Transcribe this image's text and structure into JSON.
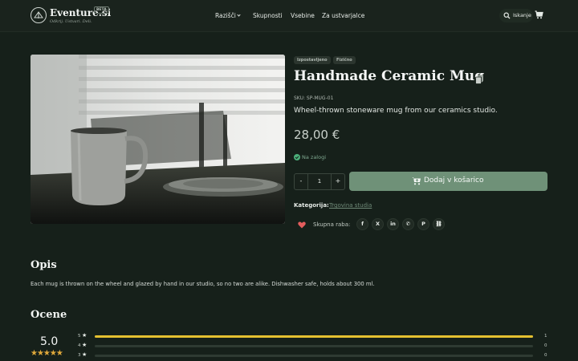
{
  "header": {
    "brand": "Eventure.si",
    "tagline": "Odkrij. Ustvari. Deli.",
    "beta": "BETA",
    "nav": [
      "Razišči",
      "Skupnosti",
      "Vsebine",
      "Za ustvarjalce"
    ],
    "search_label": "Iskanje"
  },
  "product": {
    "badges": [
      "Izpostavljeno",
      "Fizično"
    ],
    "title": "Handmade Ceramic Mug",
    "sku": "SKU: SP-MUG-01",
    "description": "Wheel-thrown stoneware mug from our ceramics studio.",
    "price": "28,00 €",
    "stock": "Na zalogi",
    "quantity": "1",
    "qty_minus": "-",
    "qty_plus": "+",
    "add_to_cart": "Dodaj v košarico",
    "category_label": "Kategorija:",
    "category_value": "Trgovina studia",
    "share_label": "Skupna raba:",
    "share_icons": [
      "f",
      "X",
      "in",
      "✆",
      "P",
      "⛓"
    ]
  },
  "description_section": {
    "heading": "Opis",
    "text": "Each mug is thrown on the wheel and glazed by hand in our studio, so no two are alike. Dishwasher safe, holds about 300 ml."
  },
  "ratings": {
    "heading": "Ocene",
    "average": "5.0",
    "stars": "★★★★★",
    "star_glyph": "★",
    "rows": [
      {
        "stars": "5",
        "count": "1",
        "fill": 1
      },
      {
        "stars": "4",
        "count": "0",
        "fill": 0
      },
      {
        "stars": "3",
        "count": "0",
        "fill": 0
      }
    ]
  },
  "colors": {
    "background": "#16201a",
    "accent_button": "#6f9178",
    "rating_bar": "#e4c030",
    "star": "#e0a93b",
    "heart": "#e35d5d",
    "stock": "#4caf7a"
  }
}
